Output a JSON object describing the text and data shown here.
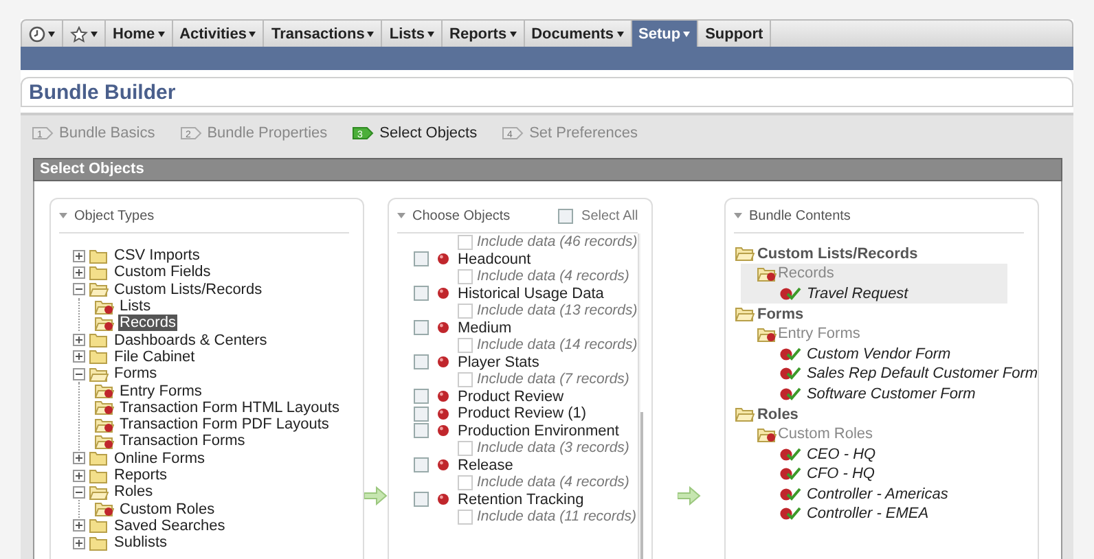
{
  "nav": {
    "icons": [
      {
        "kind": "clock"
      },
      {
        "kind": "star"
      }
    ],
    "items": [
      {
        "label": "Home",
        "has_menu": true,
        "selected": false
      },
      {
        "label": "Activities",
        "has_menu": true,
        "selected": false
      },
      {
        "label": "Transactions",
        "has_menu": true,
        "selected": false
      },
      {
        "label": "Lists",
        "has_menu": true,
        "selected": false
      },
      {
        "label": "Reports",
        "has_menu": true,
        "selected": false
      },
      {
        "label": "Documents",
        "has_menu": true,
        "selected": false
      },
      {
        "label": "Setup",
        "has_menu": true,
        "selected": true
      },
      {
        "label": "Support",
        "has_menu": false,
        "selected": false
      }
    ]
  },
  "page_title": "Bundle Builder",
  "steps": [
    {
      "number": "1",
      "label": "Bundle Basics",
      "selected": false
    },
    {
      "number": "2",
      "label": "Bundle Properties",
      "selected": false
    },
    {
      "number": "3",
      "label": "Select Objects",
      "selected": true
    },
    {
      "number": "4",
      "label": "Set Preferences",
      "selected": false
    }
  ],
  "section_title": "Select Objects",
  "object_types": {
    "title": "Object Types",
    "items": [
      {
        "label": "CSV Imports",
        "expanded": false,
        "selected": false
      },
      {
        "label": "Custom Fields",
        "expanded": false,
        "selected": false
      },
      {
        "label": "Custom Lists/Records",
        "expanded": true,
        "selected": false,
        "children": [
          {
            "label": "Lists",
            "selected": false
          },
          {
            "label": "Records",
            "selected": true
          }
        ]
      },
      {
        "label": "Dashboards & Centers",
        "expanded": false,
        "selected": false
      },
      {
        "label": "File Cabinet",
        "expanded": false,
        "selected": false
      },
      {
        "label": "Forms",
        "expanded": true,
        "selected": false,
        "children": [
          {
            "label": "Entry Forms",
            "selected": false
          },
          {
            "label": "Transaction Form HTML Layouts",
            "selected": false
          },
          {
            "label": "Transaction Form PDF Layouts",
            "selected": false
          },
          {
            "label": "Transaction Forms",
            "selected": false
          }
        ]
      },
      {
        "label": "Online Forms",
        "expanded": false,
        "selected": false
      },
      {
        "label": "Reports",
        "expanded": false,
        "selected": false
      },
      {
        "label": "Roles",
        "expanded": true,
        "selected": false,
        "children": [
          {
            "label": "Custom Roles",
            "selected": false
          }
        ]
      },
      {
        "label": "Saved Searches",
        "expanded": false,
        "selected": false
      },
      {
        "label": "Sublists",
        "expanded": false,
        "selected": false
      }
    ]
  },
  "choose_objects": {
    "title": "Choose Objects",
    "select_all": {
      "label": "Select All",
      "checked": false
    },
    "items": [
      {
        "include": "Include data (46 records)",
        "include_checked": false
      },
      {
        "name": "Headcount",
        "checked": false,
        "include": "Include data (4 records)",
        "include_checked": false
      },
      {
        "name": "Historical Usage Data",
        "checked": false,
        "include": "Include data (13 records)",
        "include_checked": false
      },
      {
        "name": "Medium",
        "checked": false,
        "include": "Include data (14 records)",
        "include_checked": false
      },
      {
        "name": "Player Stats",
        "checked": false,
        "include": "Include data (7 records)",
        "include_checked": false
      },
      {
        "name": "Product Review",
        "checked": false
      },
      {
        "name": "Product Review (1)",
        "checked": false
      },
      {
        "name": "Production Environment",
        "checked": false,
        "include": "Include data (3 records)",
        "include_checked": false
      },
      {
        "name": "Release",
        "checked": false,
        "include": "Include data (4 records)",
        "include_checked": false
      },
      {
        "name": "Retention Tracking",
        "checked": false,
        "include": "Include data (11 records)",
        "include_checked": false
      }
    ]
  },
  "bundle_contents": {
    "title": "Bundle Contents",
    "groups": [
      {
        "label": "Custom Lists/Records",
        "categories": [
          {
            "label": "Records",
            "highlighted": true,
            "items": [
              "Travel Request"
            ]
          }
        ]
      },
      {
        "label": "Forms",
        "categories": [
          {
            "label": "Entry Forms",
            "highlighted": false,
            "items": [
              "Custom Vendor Form",
              "Sales Rep Default Customer Form",
              "Software Customer Form"
            ]
          }
        ]
      },
      {
        "label": "Roles",
        "categories": [
          {
            "label": "Custom Roles",
            "highlighted": false,
            "items": [
              "CEO - HQ",
              "CFO - HQ",
              "Controller - Americas",
              "Controller - EMEA"
            ]
          }
        ]
      }
    ]
  }
}
